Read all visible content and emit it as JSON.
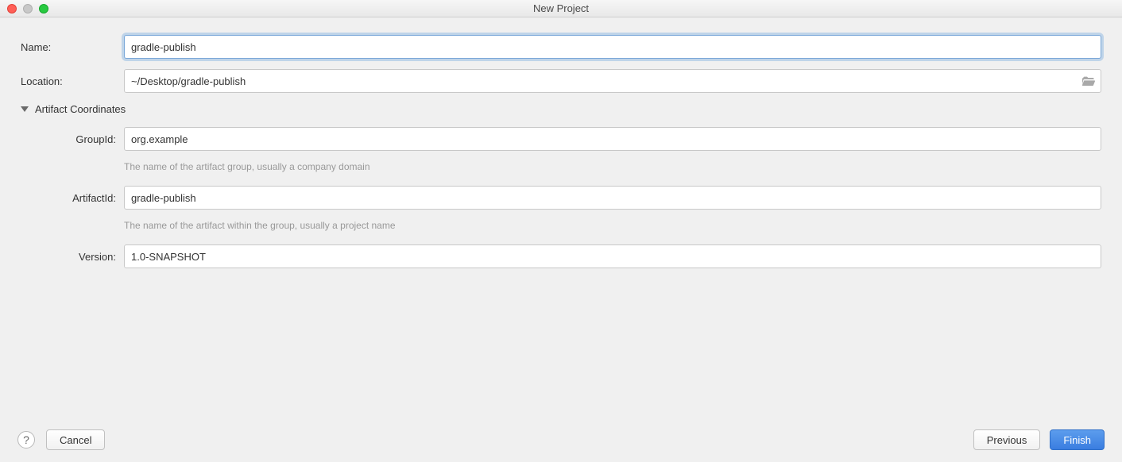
{
  "window": {
    "title": "New Project"
  },
  "form": {
    "name_label": "Name:",
    "name_value": "gradle-publish",
    "location_label": "Location:",
    "location_value": "~/Desktop/gradle-publish"
  },
  "section": {
    "title": "Artifact Coordinates",
    "groupid_label": "GroupId:",
    "groupid_value": "org.example",
    "groupid_helper": "The name of the artifact group, usually a company domain",
    "artifactid_label": "ArtifactId:",
    "artifactid_value": "gradle-publish",
    "artifactid_helper": "The name of the artifact within the group, usually a project name",
    "version_label": "Version:",
    "version_value": "1.0-SNAPSHOT"
  },
  "footer": {
    "help": "?",
    "cancel": "Cancel",
    "previous": "Previous",
    "finish": "Finish"
  }
}
